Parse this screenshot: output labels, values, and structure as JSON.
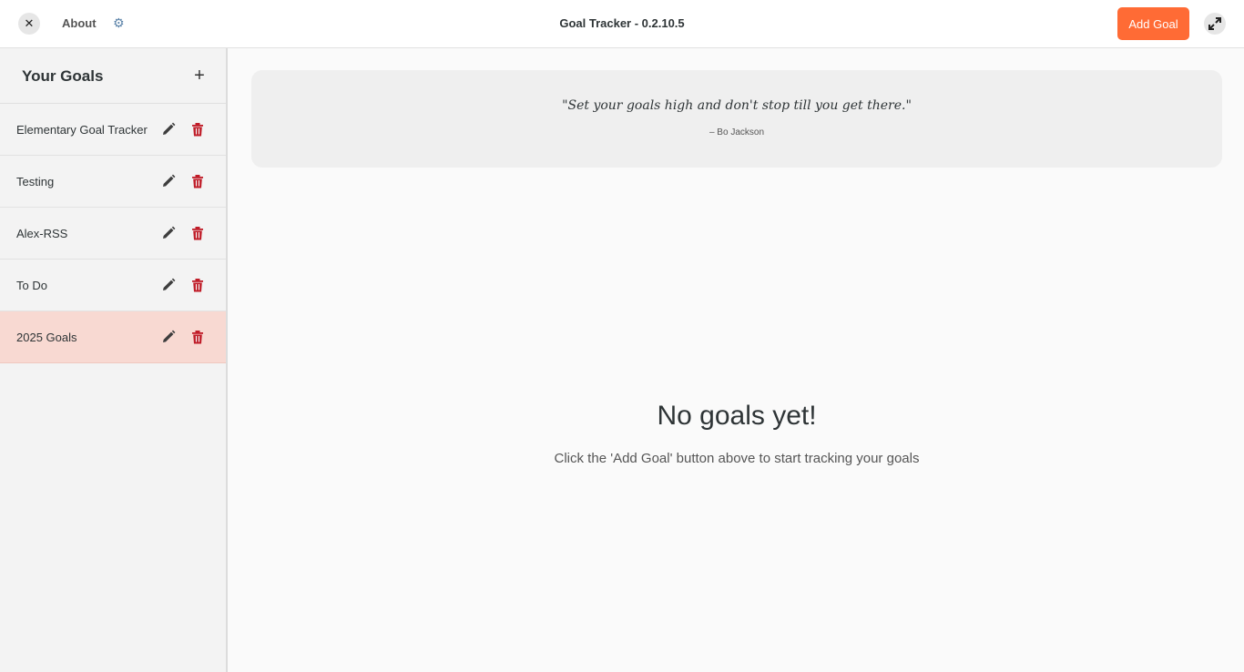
{
  "header": {
    "close_icon": "✕",
    "about_label": "About",
    "settings_icon": "⚙",
    "title": "Goal Tracker - 0.2.10.5",
    "add_goal_label": "Add Goal",
    "accent_color": "#ff6b35"
  },
  "sidebar": {
    "title": "Your Goals",
    "add_icon": "+",
    "items": [
      {
        "label": "Elementary Goal Tracker",
        "selected": false
      },
      {
        "label": "Testing",
        "selected": false
      },
      {
        "label": "Alex-RSS",
        "selected": false
      },
      {
        "label": "To Do",
        "selected": false
      },
      {
        "label": "2025 Goals",
        "selected": true
      }
    ]
  },
  "quote": {
    "text": "\"Set your goals high and don't stop till you get there.\"",
    "author": "– Bo Jackson"
  },
  "empty_state": {
    "title": "No goals yet!",
    "subtitle": "Click the 'Add Goal' button above to start tracking your goals"
  },
  "colors": {
    "delete": "#c01c28",
    "selected_row": "#f8d9d2"
  }
}
